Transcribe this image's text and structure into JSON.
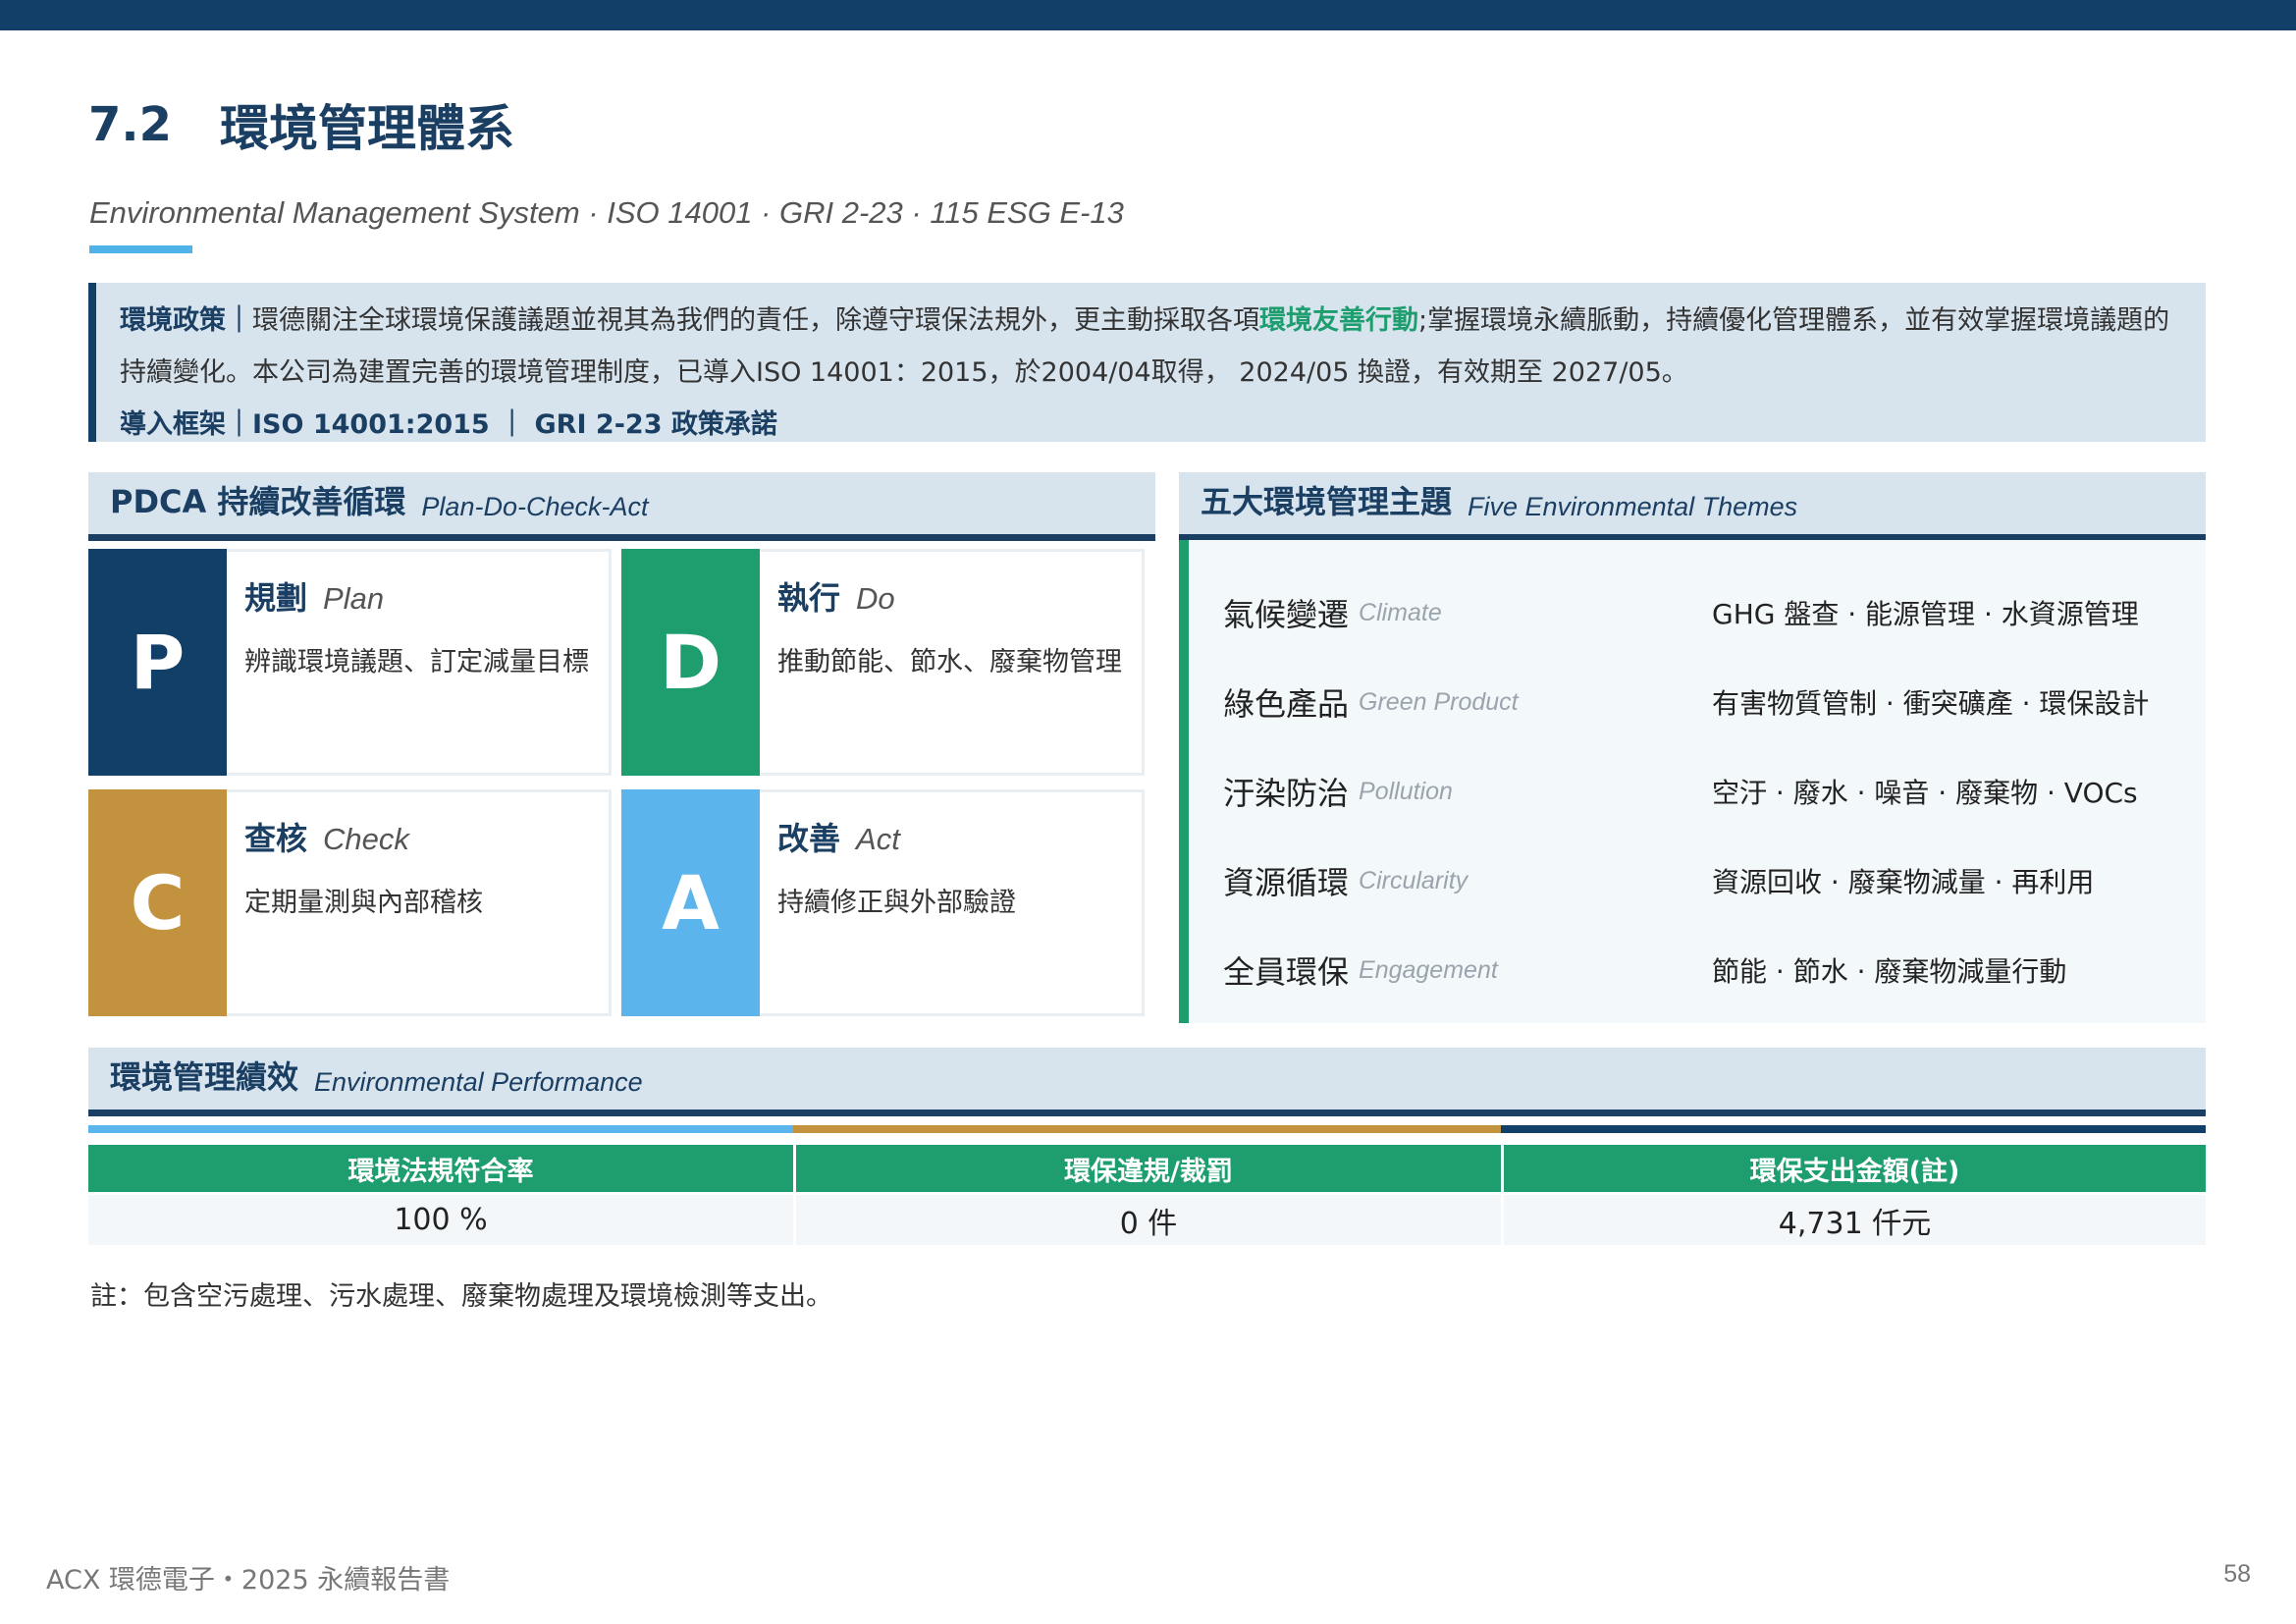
{
  "header": {
    "section_number": "7.2",
    "title": "環境管理體系",
    "subtitle": "Environmental Management System · ISO 14001 · GRI 2-23  · 115 ESG E-13"
  },
  "policy": {
    "label": "環境政策｜",
    "text_before": "環德關注全球環境保護議題並視其為我們的責任，除遵守環保法規外，更主動採取各項",
    "highlight": "環境友善行動",
    "text_after": ";掌握環境永續脈動，持續優化管理體系，並有效掌握環境議題的持續變化。本公司為建置完善的環境管理制度，已導入ISO 14001：2015，於2004/04取得， 2024/05 換證，有效期至 2027/05。",
    "framework_label": "導入框架｜",
    "framework_text": "ISO 14001:2015 ｜ GRI 2-23 政策承諾"
  },
  "pdca": {
    "title_zh": "PDCA 持續改善循環",
    "title_en": "Plan-Do-Check-Act",
    "cells": [
      {
        "letter": "P",
        "zh": "規劃",
        "en": "Plan",
        "desc": "辨識環境議題、訂定減量目標",
        "color": "#123f67"
      },
      {
        "letter": "D",
        "zh": "執行",
        "en": "Do",
        "desc": "推動節能、節水、廢棄物管理",
        "color": "#1e9e6e"
      },
      {
        "letter": "C",
        "zh": "查核",
        "en": "Check",
        "desc": "定期量測與內部稽核",
        "color": "#c2923e"
      },
      {
        "letter": "A",
        "zh": "改善",
        "en": "Act",
        "desc": "持續修正與外部驗證",
        "color": "#5bb4ec"
      }
    ]
  },
  "themes": {
    "title_zh": "五大環境管理主題",
    "title_en": "Five Environmental Themes",
    "items": [
      {
        "zh": "氣候變遷",
        "en": "Climate",
        "desc": "GHG 盤查 · 能源管理 · 水資源管理"
      },
      {
        "zh": "綠色產品",
        "en": "Green Product",
        "desc": "有害物質管制 · 衝突礦產 · 環保設計"
      },
      {
        "zh": "汙染防治",
        "en": "Pollution",
        "desc": "空汙 · 廢水 · 噪音 · 廢棄物 · VOCs"
      },
      {
        "zh": "資源循環",
        "en": "Circularity",
        "desc": "資源回收 · 廢棄物減量 · 再利用"
      },
      {
        "zh": "全員環保",
        "en": "Engagement",
        "desc": "節能 · 節水 · 廢棄物減量行動"
      }
    ]
  },
  "performance": {
    "title_zh": "環境管理績效",
    "title_en": "Environmental Performance",
    "bar_colors": [
      "#5bb4ec",
      "#c2923e",
      "#123f67"
    ],
    "columns": [
      {
        "header": "環境法規符合率",
        "value": "100 %"
      },
      {
        "header": "環保違規/裁罰",
        "value": "0 件"
      },
      {
        "header": "環保支出金額(註)",
        "value": "4,731 仟元"
      }
    ]
  },
  "note": "註：包含空污處理、污水處理、廢棄物處理及環境檢測等支出。",
  "footer": {
    "left": "ACX 環德電子・2025 永續報告書",
    "page": "58"
  }
}
